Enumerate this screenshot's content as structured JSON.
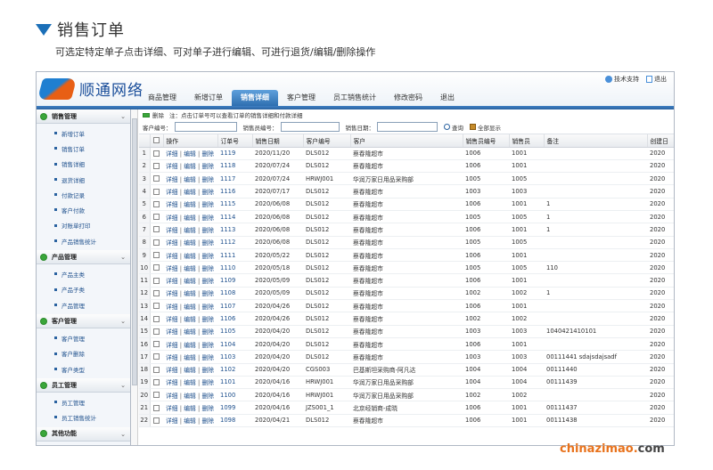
{
  "header": {
    "title": "销售订单",
    "description": "可选定特定单子点击详细、可对单子进行编辑、可进行退货/编辑/删除操作"
  },
  "app": {
    "logo_text": "顺通网络",
    "top_links": [
      "技术支持",
      "退出"
    ],
    "tabs": [
      {
        "label": "商品管理",
        "active": false
      },
      {
        "label": "新增订单",
        "active": false
      },
      {
        "label": "销售详细",
        "active": true
      },
      {
        "label": "客户管理",
        "active": false
      },
      {
        "label": "员工销售统计",
        "active": false
      },
      {
        "label": "修改密码",
        "active": false
      },
      {
        "label": "退出",
        "active": false
      }
    ]
  },
  "sidebar": {
    "groups": [
      {
        "title": "销售管理",
        "items": [
          "新增订单",
          "销售订单",
          "销售详细",
          "退货详细",
          "付款记录",
          "客户付款",
          "对账单打印",
          "产品销售统计"
        ]
      },
      {
        "title": "产品管理",
        "items": [
          "产品主类",
          "产品子类",
          "产品管理"
        ]
      },
      {
        "title": "客户管理",
        "items": [
          "客户管理",
          "客户删除",
          "客户类型"
        ]
      },
      {
        "title": "员工管理",
        "items": [
          "员工管理",
          "员工销售统计"
        ]
      },
      {
        "title": "其他功能",
        "items": []
      }
    ]
  },
  "toolbar": {
    "delete_label": "删除",
    "note": "注：点击订单号可以查看订单的销售详细和付款详细"
  },
  "search": {
    "customer_label": "客户编号：",
    "staff_label": "销售员编号：",
    "date_label": "销售日期：",
    "query_label": "查询",
    "show_all_label": "全部显示"
  },
  "table": {
    "columns": [
      "",
      "",
      "操作",
      "订单号",
      "销售日期",
      "客户编号",
      "客户",
      "销售员编号",
      "销售员",
      "备注",
      "创建日"
    ],
    "action_links": [
      "详细",
      "编辑",
      "删除"
    ],
    "rows": [
      {
        "n": "1",
        "order": "1119",
        "date": "2020/11/20",
        "cust": "DLS012",
        "name": "蔡春隆超市",
        "staff": "1006",
        "seller": "1001",
        "note": "",
        "created": "2020"
      },
      {
        "n": "2",
        "order": "1118",
        "date": "2020/07/24",
        "cust": "DLS012",
        "name": "蔡春隆超市",
        "staff": "1006",
        "seller": "1001",
        "note": "",
        "created": "2020"
      },
      {
        "n": "3",
        "order": "1117",
        "date": "2020/07/24",
        "cust": "HRWJ001",
        "name": "华润万家日用品采购部",
        "staff": "1005",
        "seller": "1005",
        "note": "",
        "created": "2020"
      },
      {
        "n": "4",
        "order": "1116",
        "date": "2020/07/17",
        "cust": "DLS012",
        "name": "蔡春隆超市",
        "staff": "1003",
        "seller": "1003",
        "note": "",
        "created": "2020"
      },
      {
        "n": "5",
        "order": "1115",
        "date": "2020/06/08",
        "cust": "DLS012",
        "name": "蔡春隆超市",
        "staff": "1006",
        "seller": "1001",
        "note": "1",
        "created": "2020"
      },
      {
        "n": "6",
        "order": "1114",
        "date": "2020/06/08",
        "cust": "DLS012",
        "name": "蔡春隆超市",
        "staff": "1005",
        "seller": "1005",
        "note": "1",
        "created": "2020"
      },
      {
        "n": "7",
        "order": "1113",
        "date": "2020/06/08",
        "cust": "DLS012",
        "name": "蔡春隆超市",
        "staff": "1006",
        "seller": "1001",
        "note": "1",
        "created": "2020"
      },
      {
        "n": "8",
        "order": "1112",
        "date": "2020/06/08",
        "cust": "DLS012",
        "name": "蔡春隆超市",
        "staff": "1005",
        "seller": "1005",
        "note": "",
        "created": "2020"
      },
      {
        "n": "9",
        "order": "1111",
        "date": "2020/05/22",
        "cust": "DLS012",
        "name": "蔡春隆超市",
        "staff": "1006",
        "seller": "1001",
        "note": "",
        "created": "2020"
      },
      {
        "n": "10",
        "order": "1110",
        "date": "2020/05/18",
        "cust": "DLS012",
        "name": "蔡春隆超市",
        "staff": "1005",
        "seller": "1005",
        "note": "110",
        "created": "2020"
      },
      {
        "n": "11",
        "order": "1109",
        "date": "2020/05/09",
        "cust": "DLS012",
        "name": "蔡春隆超市",
        "staff": "1006",
        "seller": "1001",
        "note": "",
        "created": "2020"
      },
      {
        "n": "12",
        "order": "1108",
        "date": "2020/05/09",
        "cust": "DLS012",
        "name": "蔡春隆超市",
        "staff": "1002",
        "seller": "1002",
        "note": "1",
        "created": "2020"
      },
      {
        "n": "13",
        "order": "1107",
        "date": "2020/04/26",
        "cust": "DLS012",
        "name": "蔡春隆超市",
        "staff": "1006",
        "seller": "1001",
        "note": "",
        "created": "2020"
      },
      {
        "n": "14",
        "order": "1106",
        "date": "2020/04/26",
        "cust": "DLS012",
        "name": "蔡春隆超市",
        "staff": "1002",
        "seller": "1002",
        "note": "",
        "created": "2020"
      },
      {
        "n": "15",
        "order": "1105",
        "date": "2020/04/20",
        "cust": "DLS012",
        "name": "蔡春隆超市",
        "staff": "1003",
        "seller": "1003",
        "note": "1040421410101",
        "created": "2020"
      },
      {
        "n": "16",
        "order": "1104",
        "date": "2020/04/20",
        "cust": "DLS012",
        "name": "蔡春隆超市",
        "staff": "1006",
        "seller": "1001",
        "note": "",
        "created": "2020"
      },
      {
        "n": "17",
        "order": "1103",
        "date": "2020/04/20",
        "cust": "DLS012",
        "name": "蔡春隆超市",
        "staff": "1003",
        "seller": "1003",
        "note": "00111441 sdajsdajsadf",
        "created": "2020"
      },
      {
        "n": "18",
        "order": "1102",
        "date": "2020/04/20",
        "cust": "CGS003",
        "name": "巴基斯坦采购商-阿凡达",
        "staff": "1004",
        "seller": "1004",
        "note": "00111440",
        "created": "2020"
      },
      {
        "n": "19",
        "order": "1101",
        "date": "2020/04/16",
        "cust": "HRWJ001",
        "name": "华润万家日用品采购部",
        "staff": "1004",
        "seller": "1004",
        "note": "00111439",
        "created": "2020"
      },
      {
        "n": "20",
        "order": "1100",
        "date": "2020/04/16",
        "cust": "HRWJ001",
        "name": "华润万家日用品采购部",
        "staff": "1002",
        "seller": "1002",
        "note": "",
        "created": "2020"
      },
      {
        "n": "21",
        "order": "1099",
        "date": "2020/04/16",
        "cust": "JZS001_1",
        "name": "北京经销商-成晓",
        "staff": "1006",
        "seller": "1001",
        "note": "00111437",
        "created": "2020"
      },
      {
        "n": "22",
        "order": "1098",
        "date": "2020/04/21",
        "cust": "DLS012",
        "name": "蔡春隆超市",
        "staff": "1006",
        "seller": "1001",
        "note": "00111438",
        "created": "2020"
      }
    ]
  },
  "watermark": {
    "text": "chinazimao",
    "dot": ".",
    "tld": "com"
  },
  "colors": {
    "accent": "#1b6fb8",
    "tab_active": "#2f6fb0",
    "link": "#1d4f8c",
    "watermark": "#e8721c"
  }
}
